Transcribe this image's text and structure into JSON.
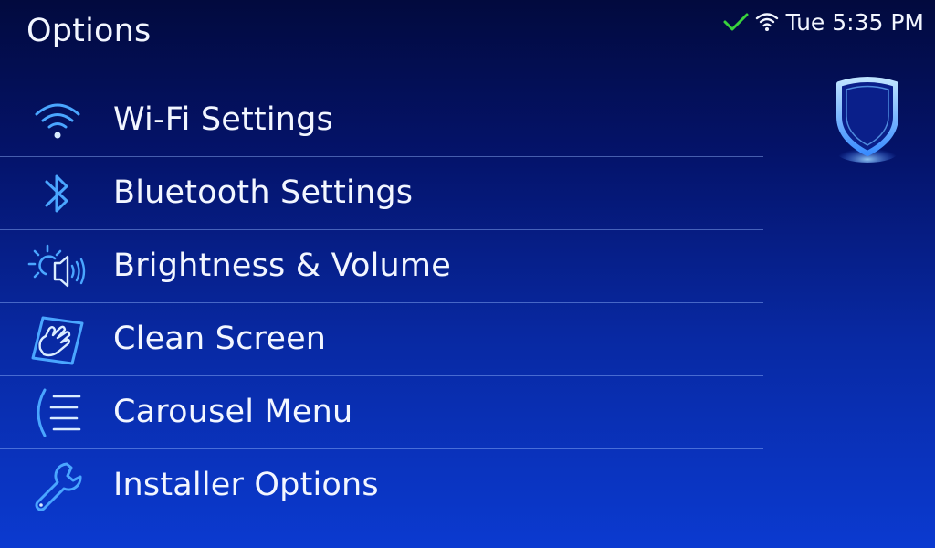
{
  "header": {
    "title": "Options"
  },
  "status": {
    "time": "Tue 5:35 PM",
    "icons": [
      "check-icon",
      "wifi-signal-icon"
    ]
  },
  "brand": {
    "icon": "shield-icon"
  },
  "colors": {
    "accent": "#4aa6ff",
    "check": "#39d33c",
    "text": "#f2f6ff"
  },
  "menu": {
    "items": [
      {
        "label": "Wi-Fi Settings",
        "icon": "wifi-icon"
      },
      {
        "label": "Bluetooth Settings",
        "icon": "bluetooth-icon"
      },
      {
        "label": "Brightness & Volume",
        "icon": "brightness-volume-icon"
      },
      {
        "label": "Clean Screen",
        "icon": "clean-screen-icon"
      },
      {
        "label": "Carousel Menu",
        "icon": "carousel-menu-icon"
      },
      {
        "label": "Installer Options",
        "icon": "wrench-icon"
      }
    ]
  }
}
